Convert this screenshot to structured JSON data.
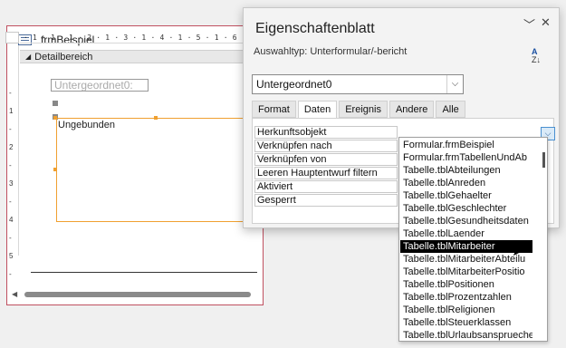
{
  "form_window": {
    "title": "frmBeispiel",
    "ruler_text": "· 1 · 1 · 1 · 2 · 1 · 3 · 1 · 4 · 1 · 5 · 1 · 6",
    "vertical_ruler": [
      "-",
      "1",
      "-",
      "2",
      "-",
      "3",
      "-",
      "4",
      "-",
      "5",
      "-"
    ],
    "section_label": "Detailbereich",
    "control_label": "Untergeordnet0:",
    "subform_text": "Ungebunden"
  },
  "property_sheet": {
    "title": "Eigenschaftenblatt",
    "collapse_icon": "chevron-down",
    "close_icon": "close",
    "selection_type": "Auswahltyp:  Unterformular/-bericht",
    "sort_icon": "sort-a-z-icon",
    "sort_top": "A",
    "sort_bottom": "Z",
    "object_combo_value": "Untergeordnet0",
    "tabs": [
      {
        "label": "Format",
        "active": false
      },
      {
        "label": "Daten",
        "active": true
      },
      {
        "label": "Ereignis",
        "active": false
      },
      {
        "label": "Andere",
        "active": false
      },
      {
        "label": "Alle",
        "active": false
      }
    ],
    "properties": [
      "Herkunftsobjekt",
      "Verknüpfen nach",
      "Verknüpfen von",
      "Leeren Hauptentwurf filtern",
      "Aktiviert",
      "Gesperrt"
    ]
  },
  "dropdown": {
    "items": [
      "Formular.frmBeispiel",
      "Formular.frmTabellenUndAb",
      "Tabelle.tblAbteilungen",
      "Tabelle.tblAnreden",
      "Tabelle.tblGehaelter",
      "Tabelle.tblGeschlechter",
      "Tabelle.tblGesundheitsdaten",
      "Tabelle.tblLaender",
      "Tabelle.tblMitarbeiter",
      "Tabelle.tblMitarbeiterAbteilu",
      "Tabelle.tblMitarbeiterPositio",
      "Tabelle.tblPositionen",
      "Tabelle.tblProzentzahlen",
      "Tabelle.tblReligionen",
      "Tabelle.tblSteuerklassen",
      "Tabelle.tblUrlaubsansprueche"
    ],
    "selected_index": 8
  },
  "colors": {
    "form_border": "#c05060",
    "subform_border": "#f0a030",
    "selection_bg": "#000000"
  }
}
